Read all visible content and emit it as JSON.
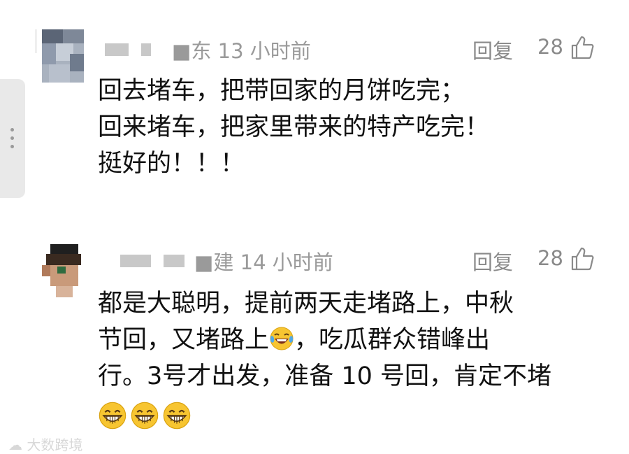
{
  "comments": [
    {
      "location": "■东 13 小时前",
      "reply_label": "回复",
      "likes": "28",
      "lines": [
        "回去堵车，把带回家的月饼吃完；",
        "回来堵车，把家里带来的特产吃完！",
        "挺好的！！！"
      ]
    },
    {
      "location": "■建 14 小时前",
      "reply_label": "回复",
      "likes": "28",
      "line1": "都是大聪明，提前两天走堵路上，中秋",
      "line2_a": "节回，又堵路上",
      "line2_b": "，吃瓜群众错峰出",
      "line3": "行。3号才出发，准备 10 号回，肯定不堵",
      "inline_emoji": "laughing-with-tears-icon",
      "trailing_emojis": [
        "grinning-face-icon",
        "grinning-face-icon",
        "grinning-face-icon"
      ]
    }
  ],
  "watermark": "大数跨境"
}
